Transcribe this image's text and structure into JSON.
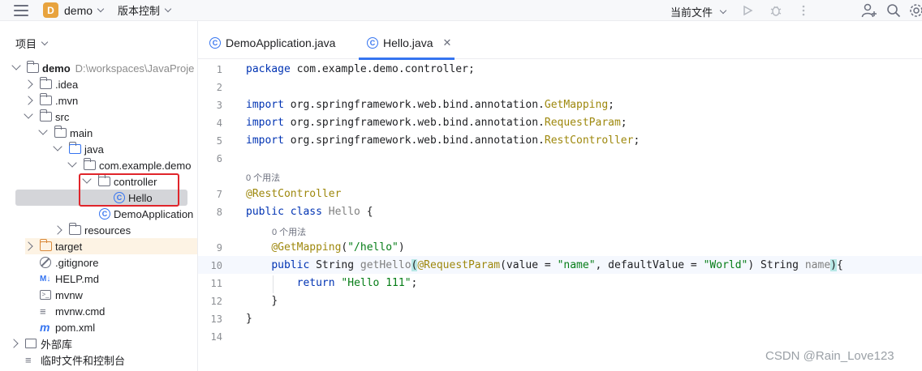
{
  "toolbar": {
    "project_letter": "D",
    "project_name": "demo",
    "vcs_label": "版本控制",
    "current_file_label": "当前文件"
  },
  "left_panel": {
    "header": "项目",
    "tree": [
      {
        "label": "demo",
        "extra": "D:\\workspaces\\JavaProje"
      },
      {
        "label": ".idea"
      },
      {
        "label": ".mvn"
      },
      {
        "label": "src"
      },
      {
        "label": "main"
      },
      {
        "label": "java"
      },
      {
        "label": "com.example.demo"
      },
      {
        "label": "controller"
      },
      {
        "label": "Hello"
      },
      {
        "label": "DemoApplication"
      },
      {
        "label": "resources"
      },
      {
        "label": "target"
      },
      {
        "label": ".gitignore"
      },
      {
        "label": "HELP.md"
      },
      {
        "label": "mvnw"
      },
      {
        "label": "mvnw.cmd"
      },
      {
        "label": "pom.xml"
      },
      {
        "label": "外部库"
      },
      {
        "label": "临时文件和控制台"
      }
    ]
  },
  "tabs": [
    {
      "label": "DemoApplication.java"
    },
    {
      "label": "Hello.java"
    }
  ],
  "editor": {
    "line_numbers": [
      "1",
      "2",
      "3",
      "4",
      "5",
      "6",
      "7",
      "8",
      "9",
      "10",
      "11",
      "12",
      "13",
      "14"
    ],
    "hint_class": "0 个用法",
    "hint_method": "0 个用法",
    "l1": {
      "kw": "package",
      "rest": " com.example.demo.controller;"
    },
    "l3": {
      "kw": "import",
      "pkg": " org.springframework.web.bind.annotation.",
      "cls": "GetMapping",
      "end": ";"
    },
    "l4": {
      "kw": "import",
      "pkg": " org.springframework.web.bind.annotation.",
      "cls": "RequestParam",
      "end": ";"
    },
    "l5": {
      "kw": "import",
      "pkg": " org.springframework.web.bind.annotation.",
      "cls": "RestController",
      "end": ";"
    },
    "l7": {
      "ann": "@RestController"
    },
    "l8": {
      "kw": "public class",
      "name": "Hello",
      "end": " {"
    },
    "l9": {
      "ann": "@GetMapping",
      "open": "(",
      "str": "\"/hello\"",
      "close": ")"
    },
    "l10": {
      "kw": "public",
      "type": " String ",
      "method": "getHello",
      "lp": "(",
      "ann": "@RequestParam",
      "args_a": "(value = ",
      "str1": "\"name\"",
      "args_b": ", defaultValue = ",
      "str2": "\"World\"",
      "args_c": ") String ",
      "param": "name",
      "rp": ")",
      "brace": "{"
    },
    "l11": {
      "kw": "return",
      "str": "\"Hello 111\"",
      "end": ";"
    },
    "l12": {
      "text": "}"
    },
    "l13": {
      "text": "}"
    }
  },
  "watermark": "CSDN @Rain_Love123"
}
